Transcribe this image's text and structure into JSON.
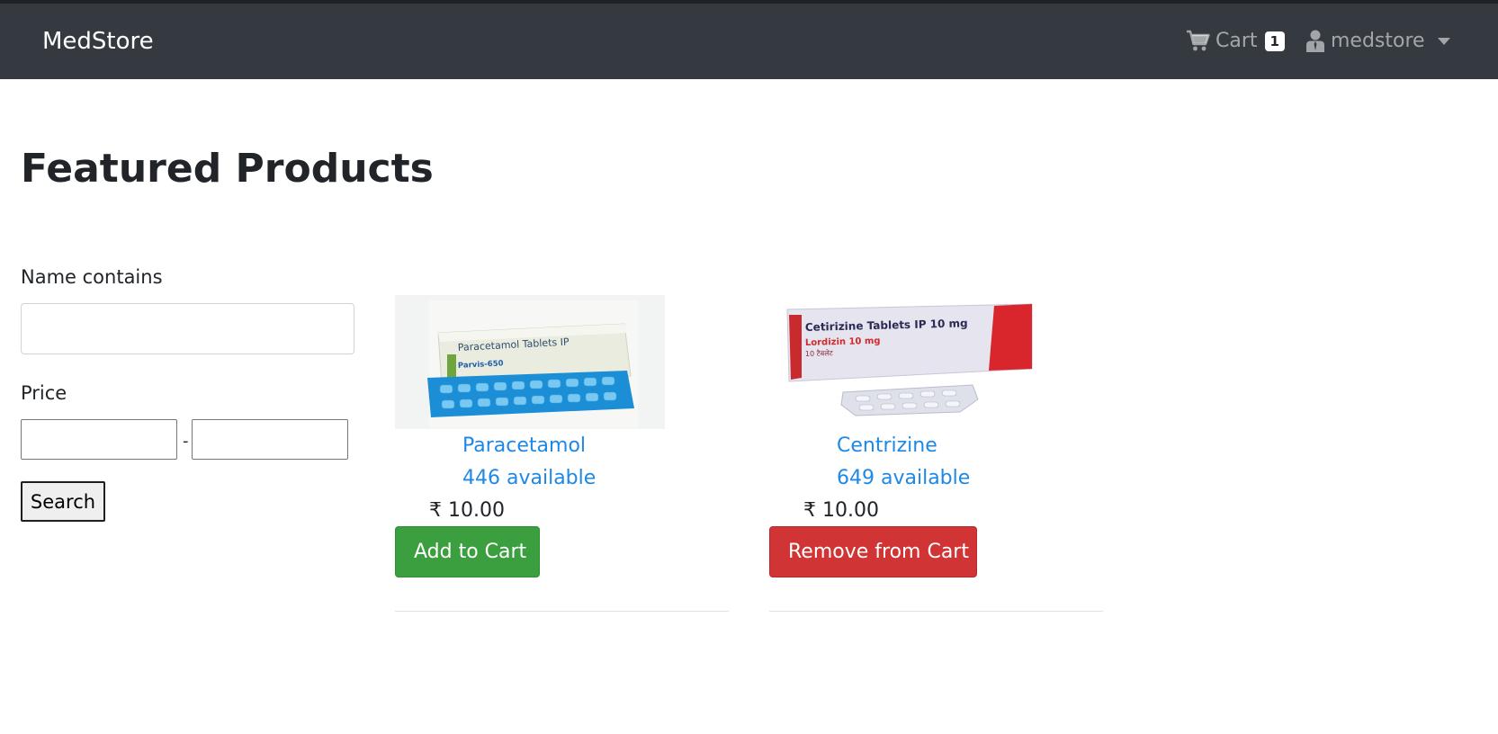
{
  "navbar": {
    "brand": "MedStore",
    "cart_label": "Cart",
    "cart_count": "1",
    "username": "medstore"
  },
  "page": {
    "title": "Featured Products"
  },
  "filters": {
    "name_label": "Name contains",
    "name_value": "",
    "price_label": "Price",
    "price_min": "",
    "price_max": "",
    "price_separator": "-",
    "search_label": "Search"
  },
  "products": [
    {
      "name": "Paracetamol",
      "stock": "446 available",
      "price": "₹ 10.00",
      "action_label": "Add to Cart",
      "image_text": {
        "line1": "Paracetamol Tablets IP",
        "line2": "Parvis-650"
      }
    },
    {
      "name": "Centrizine",
      "stock": "649 available",
      "price": "₹ 10.00",
      "action_label": "Remove from Cart",
      "image_text": {
        "line1": "Cetirizine Tablets IP 10 mg",
        "line2": "Lordizin 10 mg",
        "line3": "10 टैबलेट"
      }
    }
  ],
  "colors": {
    "navbar_bg": "#343a40",
    "link": "#1e88e5",
    "success": "#3c9f3f",
    "danger": "#d03434"
  },
  "icons": {
    "cart": "shopping-cart-icon",
    "user": "user-icon",
    "dropdown": "chevron-down-icon"
  }
}
